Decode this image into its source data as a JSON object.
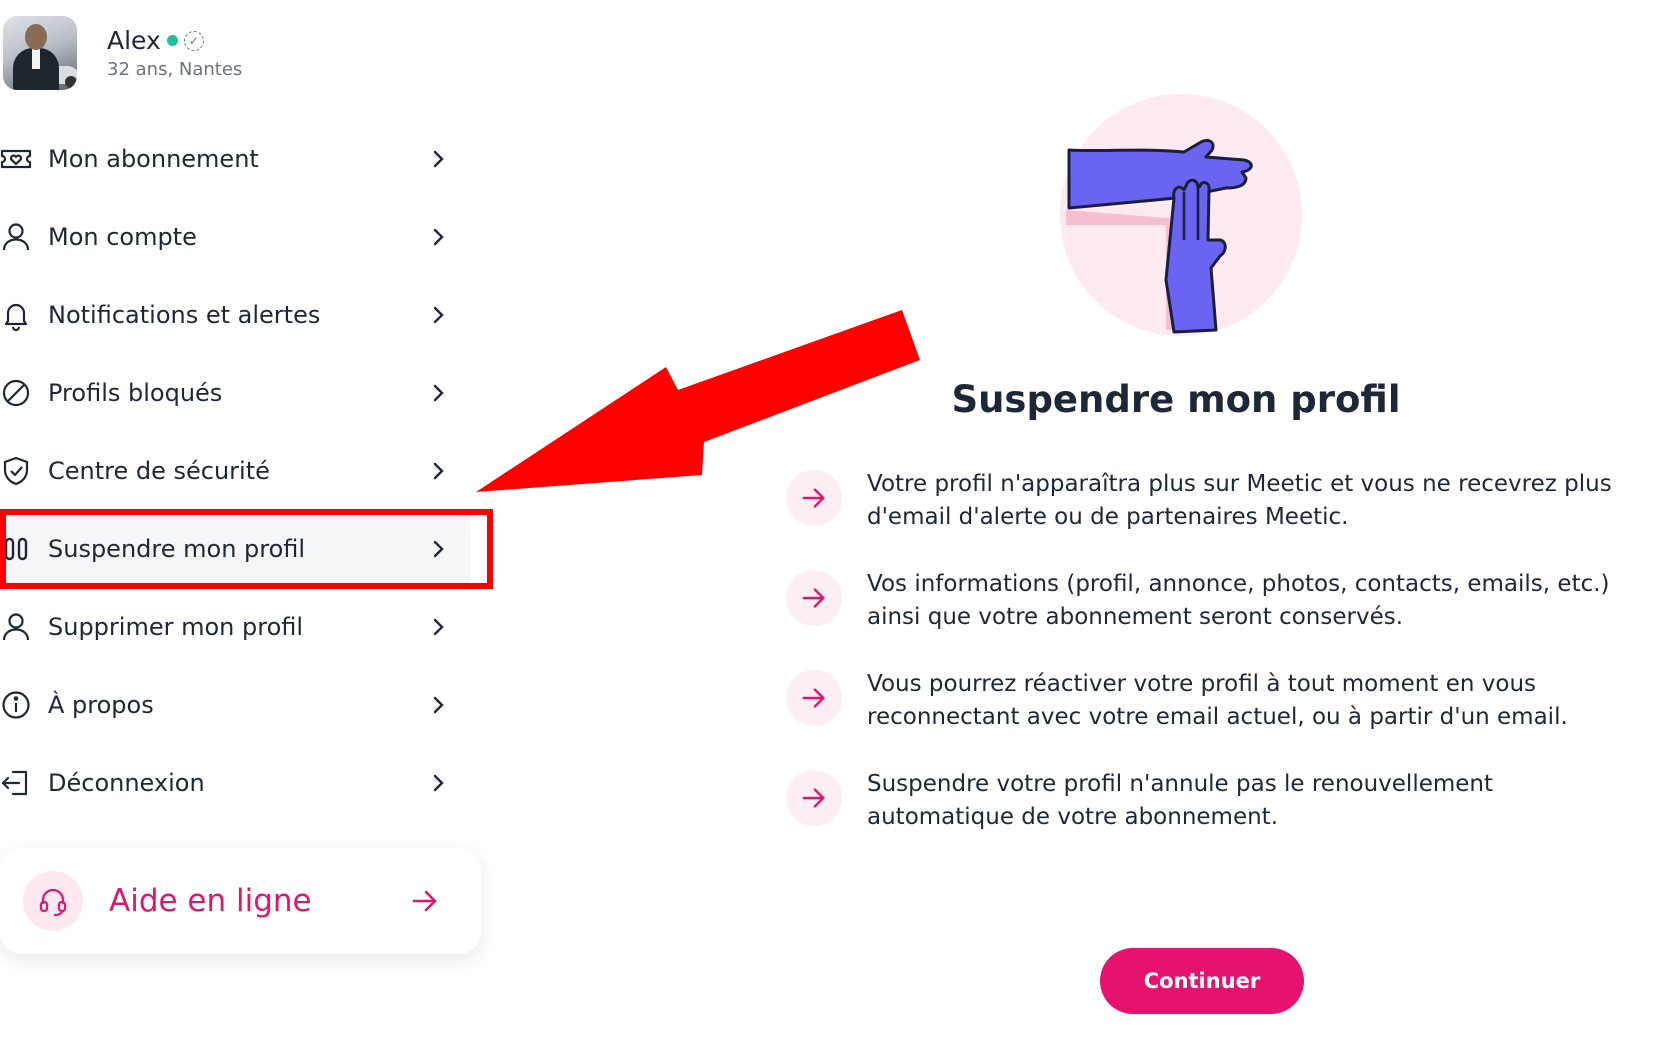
{
  "profile": {
    "name": "Alex",
    "meta": "32 ans, Nantes",
    "online_color": "#19c2a0"
  },
  "menu": {
    "items": [
      {
        "label": "Mon abonnement",
        "icon": "ticket-heart-icon"
      },
      {
        "label": "Mon compte",
        "icon": "user-icon"
      },
      {
        "label": "Notifications et alertes",
        "icon": "bell-icon"
      },
      {
        "label": "Profils bloqués",
        "icon": "blocked-icon"
      },
      {
        "label": "Centre de sécurité",
        "icon": "shield-check-icon"
      },
      {
        "label": "Suspendre mon profil",
        "icon": "pause-icon",
        "active": true
      },
      {
        "label": "Supprimer mon profil",
        "icon": "user-icon"
      },
      {
        "label": "À propos",
        "icon": "info-icon"
      },
      {
        "label": "Déconnexion",
        "icon": "logout-icon"
      }
    ]
  },
  "help": {
    "label": "Aide en ligne",
    "icon": "headset-icon"
  },
  "main": {
    "title": "Suspendre mon profil",
    "illustration": "timeout-hands-illustration",
    "bullets": [
      "Votre profil n'apparaîtra plus sur Meetic et vous ne recevrez plus d'email d'alerte ou de partenaires Meetic.",
      "Vos informations (profil, annonce, photos, contacts, emails, etc.) ainsi que votre abonnement seront conservés.",
      "Vous pourrez réactiver votre profil à tout moment en vous reconnectant avec votre email actuel, ou à partir d'un email.",
      "Suspendre votre profil n'annule pas le renouvellement automatique de votre abonnement."
    ],
    "continue_label": "Continuer"
  },
  "colors": {
    "accent": "#e5126f",
    "text": "#1c2838",
    "annotation": "#ff0000"
  }
}
